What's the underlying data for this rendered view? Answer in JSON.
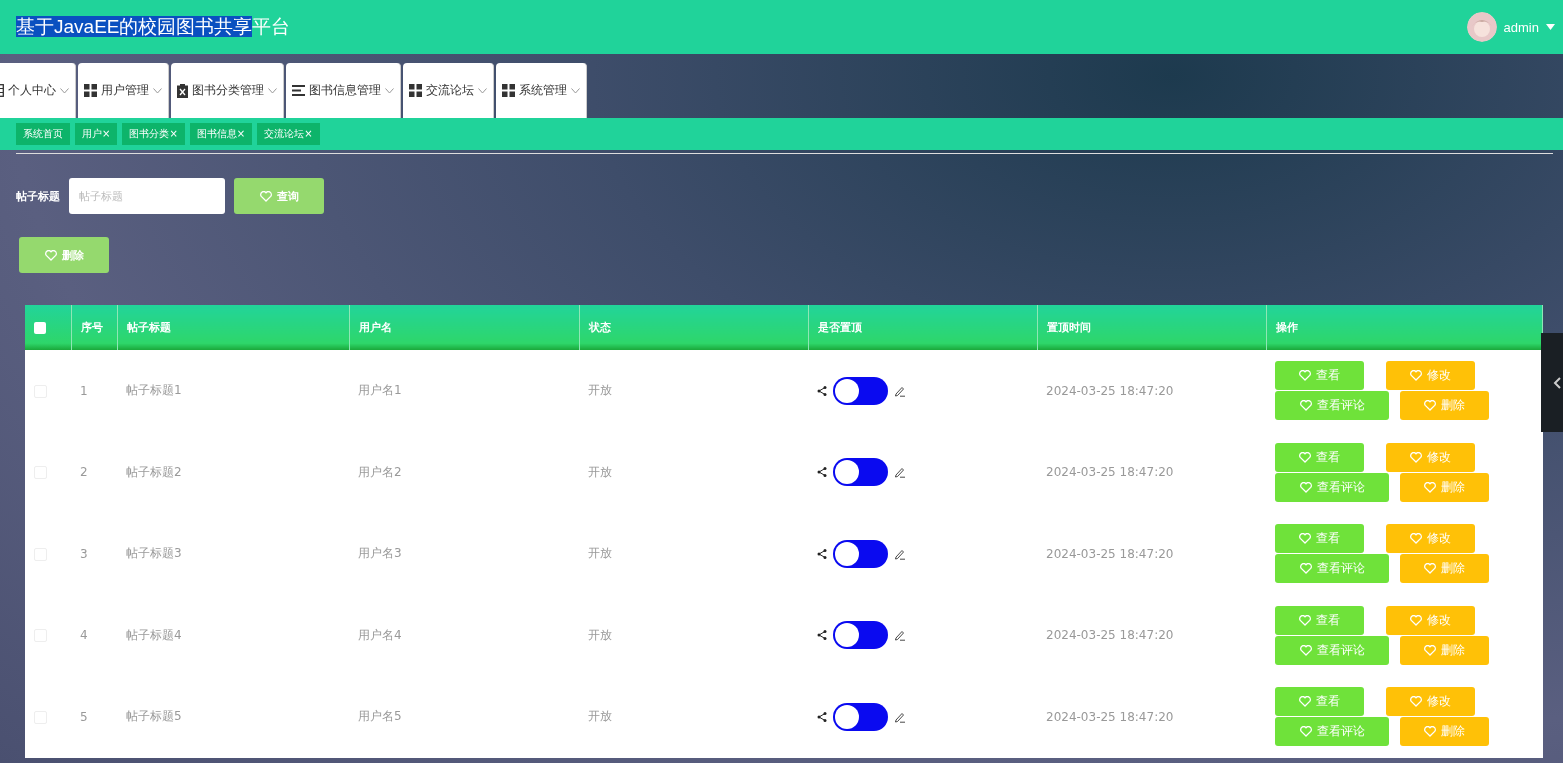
{
  "header": {
    "title_selected_part": "基于JavaEE的校园图书共享",
    "title_rest": "平台",
    "user": "admin"
  },
  "nav": [
    {
      "label": "个人中心",
      "kind": "calendar"
    },
    {
      "label": "用户管理",
      "kind": "grid"
    },
    {
      "label": "图书分类管理",
      "kind": "clipboard"
    },
    {
      "label": "图书信息管理",
      "kind": "lines"
    },
    {
      "label": "交流论坛",
      "kind": "grid"
    },
    {
      "label": "系统管理",
      "kind": "grid"
    }
  ],
  "tags": [
    {
      "label": "系统首页"
    },
    {
      "label": "用户",
      "close": "×"
    },
    {
      "label": "图书分类",
      "close": "×"
    },
    {
      "label": "图书信息",
      "close": "×"
    },
    {
      "label": "交流论坛",
      "close": "×"
    }
  ],
  "search": {
    "label": "帖子标题",
    "placeholder": "帖子标题",
    "button": "查询"
  },
  "delete_button": "删除",
  "table": {
    "columns": [
      "序号",
      "帖子标题",
      "用户名",
      "状态",
      "是否置顶",
      "置顶时间",
      "操作"
    ],
    "all_checked": false,
    "rows": [
      {
        "checked": false,
        "index": "1",
        "title": "帖子标题1",
        "user": "用户名1",
        "status": "开放",
        "pinned": false,
        "time": "2024-03-25 18:47:20",
        "actions": [
          {
            "label": "查看",
            "kind": "view"
          },
          {
            "label": "修改",
            "kind": "edit"
          },
          {
            "label": "查看评论",
            "kind": "comments"
          },
          {
            "label": "删除",
            "kind": "delete"
          }
        ]
      },
      {
        "checked": false,
        "index": "2",
        "title": "帖子标题2",
        "user": "用户名2",
        "status": "开放",
        "pinned": false,
        "time": "2024-03-25 18:47:20",
        "actions": [
          {
            "label": "查看",
            "kind": "view"
          },
          {
            "label": "修改",
            "kind": "edit"
          },
          {
            "label": "查看评论",
            "kind": "comments"
          },
          {
            "label": "删除",
            "kind": "delete"
          }
        ]
      },
      {
        "checked": false,
        "index": "3",
        "title": "帖子标题3",
        "user": "用户名3",
        "status": "开放",
        "pinned": false,
        "time": "2024-03-25 18:47:20",
        "actions": [
          {
            "label": "查看",
            "kind": "view"
          },
          {
            "label": "修改",
            "kind": "edit"
          },
          {
            "label": "查看评论",
            "kind": "comments"
          },
          {
            "label": "删除",
            "kind": "delete"
          }
        ]
      },
      {
        "checked": false,
        "index": "4",
        "title": "帖子标题4",
        "user": "用户名4",
        "status": "开放",
        "pinned": false,
        "time": "2024-03-25 18:47:20",
        "actions": [
          {
            "label": "查看",
            "kind": "view"
          },
          {
            "label": "修改",
            "kind": "edit"
          },
          {
            "label": "查看评论",
            "kind": "comments"
          },
          {
            "label": "删除",
            "kind": "delete"
          }
        ]
      },
      {
        "checked": false,
        "index": "5",
        "title": "帖子标题5",
        "user": "用户名5",
        "status": "开放",
        "pinned": false,
        "time": "2024-03-25 18:47:20",
        "actions": [
          {
            "label": "查看",
            "kind": "view"
          },
          {
            "label": "修改",
            "kind": "edit"
          },
          {
            "label": "查看评论",
            "kind": "comments"
          },
          {
            "label": "删除",
            "kind": "delete"
          }
        ]
      }
    ]
  }
}
